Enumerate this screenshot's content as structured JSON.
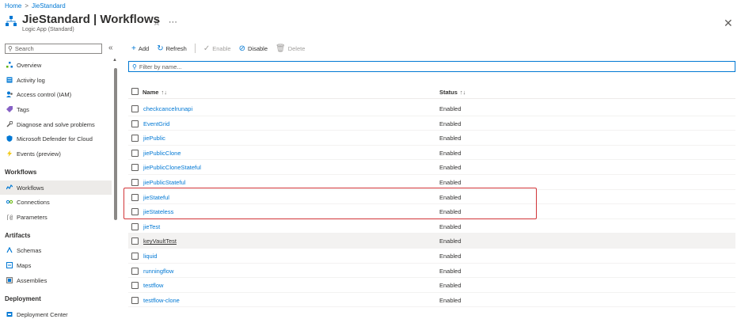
{
  "breadcrumb": {
    "home": "Home",
    "separator": ">",
    "current": "JieStandard"
  },
  "header": {
    "title": "JieStandard | Workflows",
    "subtitle": "Logic App (Standard)",
    "favorite_icon": "star-outline-icon",
    "more_label": "···",
    "close_label": "✕"
  },
  "sidebar": {
    "search_placeholder": "Search",
    "collapse_label": "«",
    "items_top": [
      {
        "label": "Overview",
        "icon": "overview-icon"
      },
      {
        "label": "Activity log",
        "icon": "activity-log-icon"
      },
      {
        "label": "Access control (IAM)",
        "icon": "iam-icon"
      },
      {
        "label": "Tags",
        "icon": "tag-icon"
      },
      {
        "label": "Diagnose and solve problems",
        "icon": "wrench-icon"
      },
      {
        "label": "Microsoft Defender for Cloud",
        "icon": "shield-icon"
      },
      {
        "label": "Events (preview)",
        "icon": "lightning-icon"
      }
    ],
    "section_workflows": "Workflows",
    "items_workflows": [
      {
        "label": "Workflows",
        "icon": "workflows-icon",
        "active": true
      },
      {
        "label": "Connections",
        "icon": "connections-icon"
      },
      {
        "label": "Parameters",
        "icon": "parameters-icon"
      }
    ],
    "section_artifacts": "Artifacts",
    "items_artifacts": [
      {
        "label": "Schemas",
        "icon": "schemas-icon"
      },
      {
        "label": "Maps",
        "icon": "maps-icon"
      },
      {
        "label": "Assemblies",
        "icon": "assemblies-icon"
      }
    ],
    "section_deployment": "Deployment",
    "items_deployment": [
      {
        "label": "Deployment Center",
        "icon": "deployment-center-icon"
      }
    ]
  },
  "toolbar": {
    "add": "Add",
    "refresh": "Refresh",
    "enable": "Enable",
    "disable": "Disable",
    "delete": "Delete"
  },
  "filter": {
    "placeholder": "Filter by name..."
  },
  "table": {
    "col_name": "Name",
    "col_name_sort": "↑↓",
    "col_status": "Status",
    "col_status_sort": "↑↓",
    "rows": [
      {
        "name": "checkcancelrunapi",
        "status": "Enabled"
      },
      {
        "name": "EventGrid",
        "status": "Enabled"
      },
      {
        "name": "jiePublic",
        "status": "Enabled"
      },
      {
        "name": "jiePublicClone",
        "status": "Enabled"
      },
      {
        "name": "jiePublicCloneStateful",
        "status": "Enabled"
      },
      {
        "name": "jiePublicStateful",
        "status": "Enabled"
      },
      {
        "name": "jieStateful",
        "status": "Enabled"
      },
      {
        "name": "jieStateless",
        "status": "Enabled"
      },
      {
        "name": "jieTest",
        "status": "Enabled"
      },
      {
        "name": "keyVaultTest",
        "status": "Enabled"
      },
      {
        "name": "liquid",
        "status": "Enabled"
      },
      {
        "name": "runningflow",
        "status": "Enabled"
      },
      {
        "name": "testflow",
        "status": "Enabled"
      },
      {
        "name": "testflow-clone",
        "status": "Enabled"
      }
    ]
  },
  "colors": {
    "accent": "#0078d4",
    "highlight": "#d13438"
  }
}
